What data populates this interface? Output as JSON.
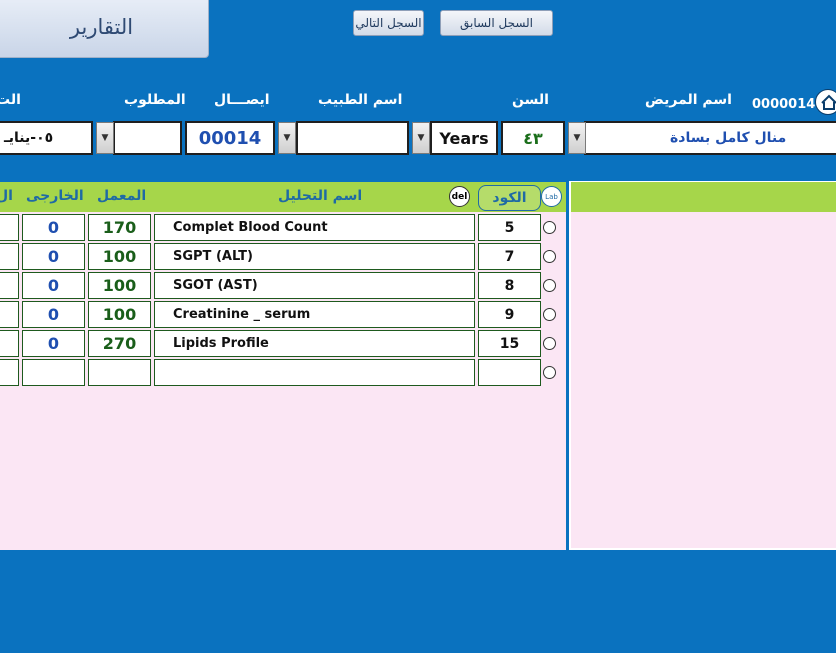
{
  "toolbar": {
    "reports": "التقارير",
    "prev_record": "السجل السابق",
    "next_record": "السجل التالي"
  },
  "record_id": "0000014",
  "headers": {
    "patient_name": "اسم المريض",
    "age": "السن",
    "doctor_name": "اسم الطبيب",
    "receipt": "ايصـــال",
    "required": "المطلوب",
    "date_partial": "الت"
  },
  "form": {
    "patient_name": "منال كامل بسادة",
    "age_value": "٤٣",
    "age_unit": "Years",
    "doctor_name": "",
    "receipt_no": "00014",
    "required": "",
    "date_partial": "٠٥-ينايـ"
  },
  "grid": {
    "lab_badge": "Lab",
    "code_header": "الكود",
    "del_badge": "del",
    "test_header": "اسم التحليل",
    "lab_price_header": "المعمل",
    "external_header": "الخارجى",
    "partial_header": "ال",
    "rows": [
      {
        "code": "5",
        "test": "Complet Blood Count",
        "lab": "170",
        "external": "0"
      },
      {
        "code": "7",
        "test": "SGPT (ALT)",
        "lab": "100",
        "external": "0"
      },
      {
        "code": "8",
        "test": "SGOT (AST)",
        "lab": "100",
        "external": "0"
      },
      {
        "code": "9",
        "test": "Creatinine _ serum",
        "lab": "100",
        "external": "0"
      },
      {
        "code": "15",
        "test": "Lipids Profile",
        "lab": "270",
        "external": "0"
      },
      {
        "code": "",
        "test": "",
        "lab": "",
        "external": ""
      }
    ]
  },
  "colors": {
    "background": "#0a72bf",
    "grid_header": "#a6d64a",
    "panel": "#fbe6f4",
    "lab_value": "#1a5e1a",
    "external_value": "#1f4fb0"
  }
}
